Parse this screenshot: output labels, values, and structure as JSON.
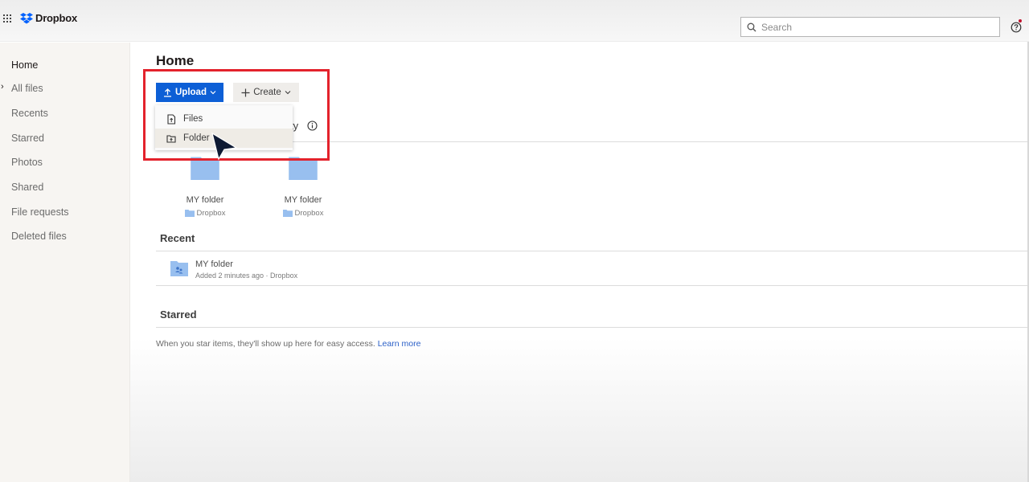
{
  "app": {
    "brand": "Dropbox",
    "brand_color": "#0061fe",
    "accent_color": "#0d5fd6"
  },
  "topbar": {
    "search_placeholder": "Search",
    "help_badge_color": "#c0142e"
  },
  "sidebar": {
    "items": [
      {
        "label": "Home",
        "active": true
      },
      {
        "label": "All files",
        "expandable": true
      },
      {
        "label": "Recents"
      },
      {
        "label": "Starred"
      },
      {
        "label": "Photos"
      },
      {
        "label": "Shared"
      },
      {
        "label": "File requests"
      },
      {
        "label": "Deleted files"
      }
    ]
  },
  "main": {
    "title": "Home",
    "upload_label": "Upload",
    "create_label": "Create",
    "upload_menu": [
      {
        "label": "Files",
        "icon": "file-upload-icon"
      },
      {
        "label": "Folder",
        "icon": "folder-upload-icon",
        "hovered": true
      }
    ],
    "suggested_heading_visible": "ty",
    "suggested": [
      {
        "name": "MY folder",
        "location": "Dropbox"
      },
      {
        "name": "MY folder",
        "location": "Dropbox"
      }
    ],
    "recent_title": "Recent",
    "recent": [
      {
        "name": "MY folder",
        "meta": "Added 2 minutes ago · Dropbox"
      }
    ],
    "starred_title": "Starred",
    "starred_empty_text": "When you star items, they'll show up here for easy access. ",
    "starred_learn_more": "Learn more"
  },
  "annotation": {
    "highlight_color": "#e3222c"
  }
}
